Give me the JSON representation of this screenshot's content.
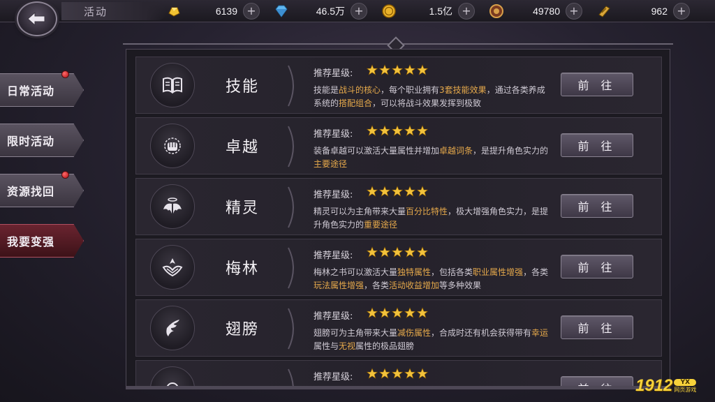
{
  "header": {
    "title": "活动",
    "back_icon": "back-arrow-icon"
  },
  "resources": [
    {
      "icon": "gold-ingot-icon",
      "value": "6139"
    },
    {
      "icon": "diamond-icon",
      "value": "46.5万"
    },
    {
      "icon": "gold-coin-icon",
      "value": "1.5亿"
    },
    {
      "icon": "compass-medal-icon",
      "value": "49780"
    },
    {
      "icon": "scroll-token-icon",
      "value": "962"
    }
  ],
  "sidebar": {
    "items": [
      {
        "label": "日常活动",
        "badge": true
      },
      {
        "label": "限时活动",
        "badge": false
      },
      {
        "label": "资源找回",
        "badge": true
      },
      {
        "label": "我要变强",
        "badge": false,
        "active": true
      }
    ]
  },
  "recommend_label": "推荐星级:",
  "go_label": "前 往",
  "rows": [
    {
      "name": "技能",
      "icon": "book-icon",
      "stars": 5,
      "desc_parts": [
        {
          "text": "技能是",
          "hl": false
        },
        {
          "text": "战斗的核心",
          "hl": true
        },
        {
          "text": "，每个职业拥有",
          "hl": false
        },
        {
          "text": "3套技能效果",
          "hl": true
        },
        {
          "text": "，通过各类养成系统的",
          "hl": false
        },
        {
          "text": "搭配组合",
          "hl": true
        },
        {
          "text": "，可以将战斗效果发挥到极致",
          "hl": false
        }
      ]
    },
    {
      "name": "卓越",
      "icon": "fist-sun-icon",
      "stars": 5,
      "desc_parts": [
        {
          "text": "装备卓越可以激活大量属性并增加",
          "hl": false
        },
        {
          "text": "卓越词条",
          "hl": true
        },
        {
          "text": "，是提升角色实力的",
          "hl": false
        },
        {
          "text": "主要途径",
          "hl": true
        }
      ]
    },
    {
      "name": "精灵",
      "icon": "winged-halo-icon",
      "stars": 5,
      "desc_parts": [
        {
          "text": "精灵可以为主角带来大量",
          "hl": false
        },
        {
          "text": "百分比特性",
          "hl": true
        },
        {
          "text": "，极大增强角色实力，是提升角色实力的",
          "hl": false
        },
        {
          "text": "重要途径",
          "hl": true
        }
      ]
    },
    {
      "name": "梅林",
      "icon": "crown-crest-icon",
      "stars": 5,
      "desc_parts": [
        {
          "text": "梅林之书可以激活大量",
          "hl": false
        },
        {
          "text": "独特属性",
          "hl": true
        },
        {
          "text": "，包括各类",
          "hl": false
        },
        {
          "text": "职业属性增强",
          "hl": true
        },
        {
          "text": "，各类",
          "hl": false
        },
        {
          "text": "玩法属性增强",
          "hl": true
        },
        {
          "text": "，各类",
          "hl": false
        },
        {
          "text": "活动收益增加",
          "hl": true
        },
        {
          "text": "等多种效果",
          "hl": false
        }
      ]
    },
    {
      "name": "翅膀",
      "icon": "wing-icon",
      "stars": 5,
      "desc_parts": [
        {
          "text": "翅膀可为主角带来大量",
          "hl": false
        },
        {
          "text": "减伤属性",
          "hl": true
        },
        {
          "text": "，合成时还有机会获得带有",
          "hl": false
        },
        {
          "text": "幸运",
          "hl": true
        },
        {
          "text": "属性与",
          "hl": false
        },
        {
          "text": "无视",
          "hl": true
        },
        {
          "text": "属性的极品翅膀",
          "hl": false
        }
      ]
    },
    {
      "name": "",
      "icon": "partial-icon",
      "stars": 5,
      "desc_parts": []
    }
  ],
  "watermark": {
    "number": "1912",
    "badge": "YX",
    "sub": "网页游戏"
  },
  "colors": {
    "highlight": "#e6a94b",
    "star": "#f2c23c",
    "active_tab": "#6a2430",
    "badge_red": "#d0141a"
  }
}
